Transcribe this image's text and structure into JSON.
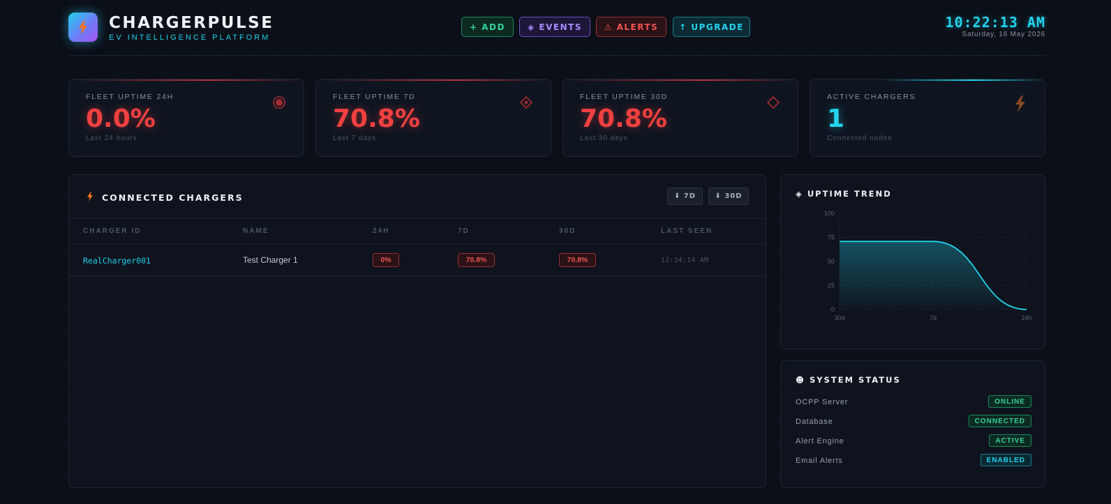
{
  "header": {
    "brand": "CHARGERPULSE",
    "tagline": "EV INTELLIGENCE PLATFORM",
    "buttons": {
      "add": "+ ADD",
      "events": "◈ EVENTS",
      "alerts": "⚠ ALERTS",
      "upgrade": "↑ UPGRADE"
    },
    "time": "10:22:13 AM",
    "date": "Saturday, 16 May 2026"
  },
  "stats": [
    {
      "label": "FLEET UPTIME 24H",
      "value": "0.0%",
      "sub": "Last 24 hours",
      "icon": "target-icon"
    },
    {
      "label": "FLEET UPTIME 7D",
      "value": "70.8%",
      "sub": "Last 7 days",
      "icon": "diamond-dot-icon"
    },
    {
      "label": "FLEET UPTIME 30D",
      "value": "70.8%",
      "sub": "Last 30 days",
      "icon": "diamond-icon"
    },
    {
      "label": "ACTIVE CHARGERS",
      "value": "1",
      "sub": "Connected nodes",
      "icon": "lightning-icon"
    }
  ],
  "chargers": {
    "title": "CONNECTED CHARGERS",
    "export_7d": "⬇ 7D",
    "export_30d": "⬇ 30D",
    "columns": [
      "CHARGER ID",
      "NAME",
      "24H",
      "7D",
      "30D",
      "LAST SEEN"
    ],
    "rows": [
      {
        "id": "RealCharger001",
        "name": "Test Charger 1",
        "u24": "0%",
        "u7": "70.8%",
        "u30": "70.8%",
        "last_seen": "12:34:14 AM"
      }
    ]
  },
  "trend": {
    "title": "◈ UPTIME TREND",
    "chart_data": {
      "type": "area",
      "x": [
        "30d",
        "7d",
        "24h"
      ],
      "series": [
        {
          "values": [
            70.8,
            70.8,
            0
          ]
        }
      ],
      "yticks": [
        0,
        25,
        50,
        75,
        100
      ],
      "ylim": [
        0,
        100
      ],
      "grid": true,
      "color": "#22d3ee"
    }
  },
  "status": {
    "title": "☻ SYSTEM STATUS",
    "items": [
      {
        "label": "OCPP Server",
        "value": "ONLINE",
        "tone": "green"
      },
      {
        "label": "Database",
        "value": "CONNECTED",
        "tone": "green"
      },
      {
        "label": "Alert Engine",
        "value": "ACTIVE",
        "tone": "green"
      },
      {
        "label": "Email Alerts",
        "value": "ENABLED",
        "tone": "cyan"
      }
    ]
  },
  "colors": {
    "accent": "#22d3ee",
    "danger": "#f04040",
    "success": "#34d399",
    "purple": "#a78bfa"
  }
}
